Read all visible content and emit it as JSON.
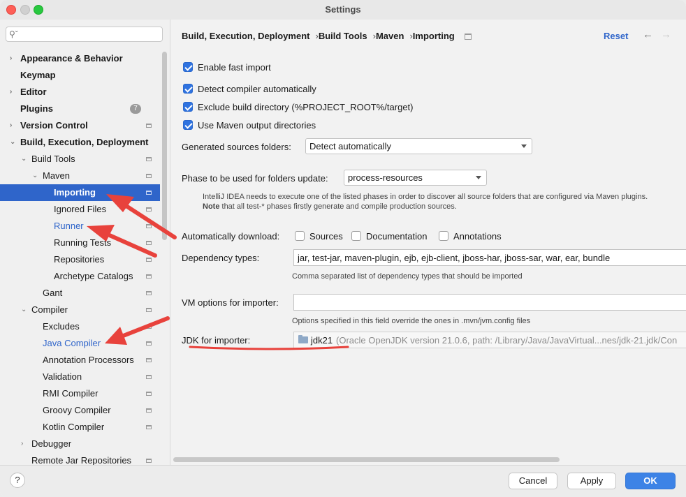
{
  "window": {
    "title": "Settings"
  },
  "sidebar": {
    "search": {
      "placeholder": ""
    },
    "items": [
      {
        "label": "Appearance & Behavior",
        "arrow": "›"
      },
      {
        "label": "Keymap"
      },
      {
        "label": "Editor",
        "arrow": "›"
      },
      {
        "label": "Plugins",
        "badge": "7"
      },
      {
        "label": "Version Control",
        "arrow": "›"
      },
      {
        "label": "Build, Execution, Deployment",
        "arrow": "⌄"
      },
      {
        "label": "Build Tools",
        "arrow": "⌄"
      },
      {
        "label": "Maven",
        "arrow": "⌄"
      },
      {
        "label": "Importing"
      },
      {
        "label": "Ignored Files"
      },
      {
        "label": "Runner"
      },
      {
        "label": "Running Tests"
      },
      {
        "label": "Repositories"
      },
      {
        "label": "Archetype Catalogs"
      },
      {
        "label": "Gant"
      },
      {
        "label": "Compiler",
        "arrow": "⌄"
      },
      {
        "label": "Excludes"
      },
      {
        "label": "Java Compiler"
      },
      {
        "label": "Annotation Processors"
      },
      {
        "label": "Validation"
      },
      {
        "label": "RMI Compiler"
      },
      {
        "label": "Groovy Compiler"
      },
      {
        "label": "Kotlin Compiler"
      },
      {
        "label": "Debugger",
        "arrow": "›"
      },
      {
        "label": "Remote Jar Repositories"
      }
    ]
  },
  "breadcrumb": {
    "items": [
      "Build, Execution, Deployment",
      "Build Tools",
      "Maven",
      "Importing"
    ],
    "separator": "›"
  },
  "header": {
    "reset_label": "Reset",
    "back_icon": "←",
    "forward_icon": "→"
  },
  "options": {
    "enable_fast_import": "Enable fast import",
    "detect_compiler": "Detect compiler automatically",
    "exclude_build_dir": "Exclude build directory (%PROJECT_ROOT%/target)",
    "use_maven_output": "Use Maven output directories",
    "generated_sources_label": "Generated sources folders:",
    "generated_sources_value": "Detect automatically",
    "phase_label": "Phase to be used for folders update:",
    "phase_value": "process-resources",
    "phase_hint_1": "IntelliJ IDEA needs to execute one of the listed phases in order to discover all source folders that are configured via Maven plugins.",
    "phase_hint_2_bold": "Note",
    "phase_hint_2": " that all test-* phases firstly generate and compile production sources.",
    "auto_download_label": "Automatically download:",
    "sources": "Sources",
    "documentation": "Documentation",
    "annotations": "Annotations",
    "dependency_types_label": "Dependency types:",
    "dependency_types_value": "jar, test-jar, maven-plugin, ejb, ejb-client, jboss-har, jboss-sar, war, ear, bundle",
    "dependency_types_hint": "Comma separated list of dependency types that should be imported",
    "vm_options_label": "VM options for importer:",
    "vm_options_value": "",
    "vm_options_hint": "Options specified in this field override the ones in .mvn/jvm.config files",
    "jdk_label": "JDK for importer:",
    "jdk_name": "jdk21",
    "jdk_detail": "(Oracle OpenJDK version 21.0.6, path: /Library/Java/JavaVirtual...nes/jdk-21.jdk/Con"
  },
  "footer": {
    "help": "?",
    "cancel": "Cancel",
    "apply": "Apply",
    "ok": "OK"
  },
  "colors": {
    "accent": "#2f65ca",
    "annotation": "#e8423c"
  }
}
